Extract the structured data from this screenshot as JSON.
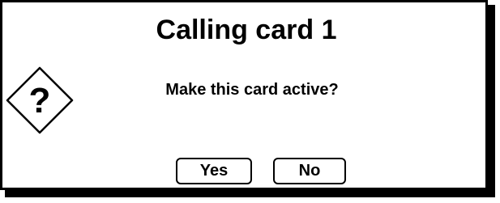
{
  "dialog": {
    "title": "Calling card 1",
    "message": "Make this card active?",
    "icon": "question-diamond-icon",
    "icon_glyph": "?",
    "buttons": {
      "yes_label": "Yes",
      "no_label": "No"
    }
  },
  "colors": {
    "foreground": "#000000",
    "background": "#ffffff"
  }
}
